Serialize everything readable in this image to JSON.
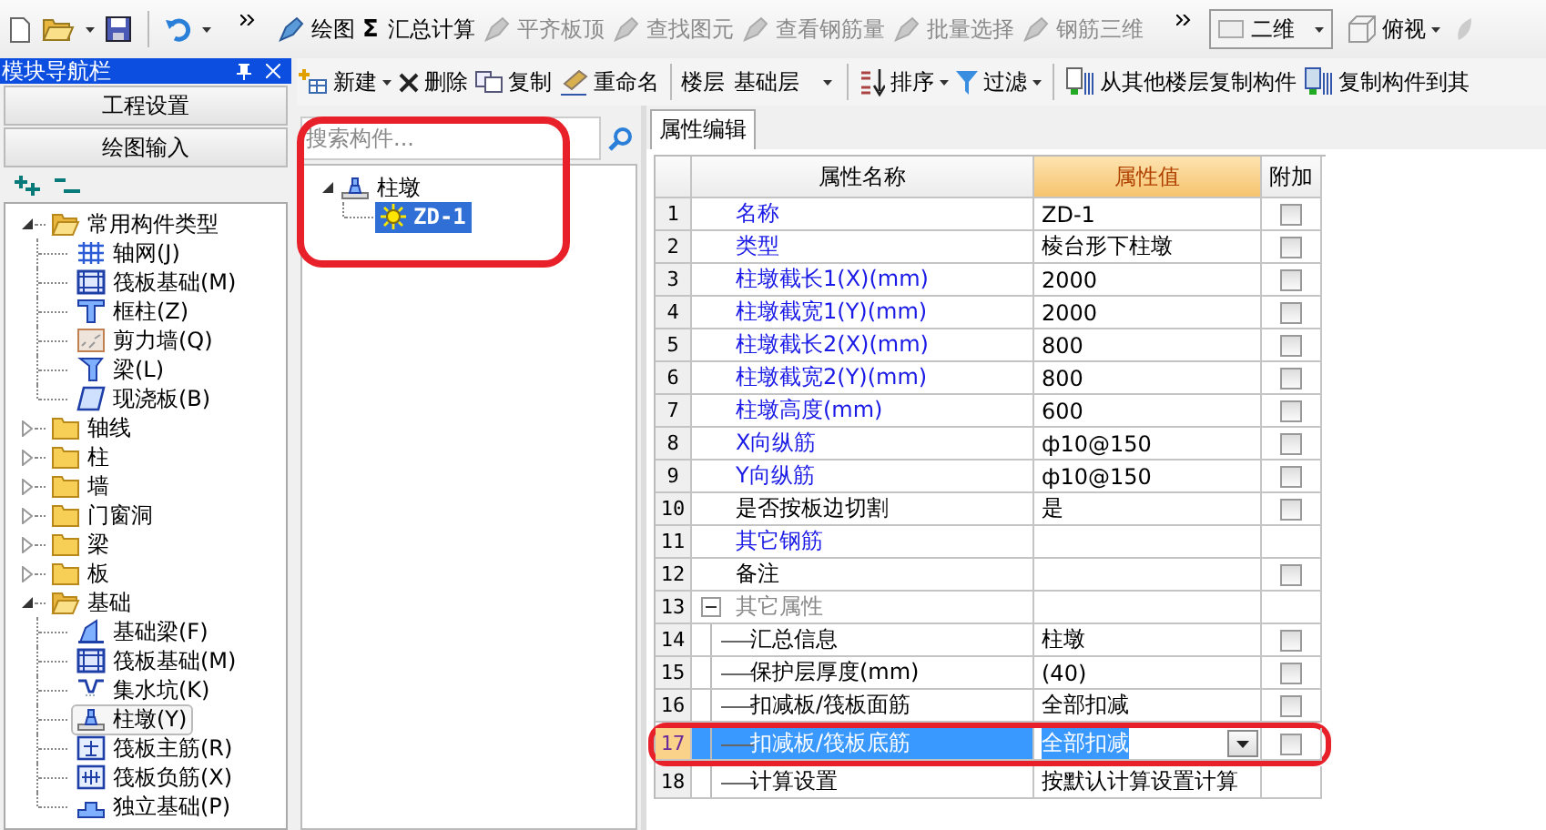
{
  "toolbar": {
    "tools": [
      {
        "label": "绘图",
        "disabled": false
      },
      {
        "label": "汇总计算",
        "symbol": "Σ",
        "disabled": false
      },
      {
        "label": "平齐板顶",
        "disabled": true
      },
      {
        "label": "查找图元",
        "disabled": true
      },
      {
        "label": "查看钢筋量",
        "disabled": true
      },
      {
        "label": "批量选择",
        "disabled": true
      },
      {
        "label": "钢筋三维",
        "disabled": true
      }
    ],
    "view_select": "二维",
    "view_button": "俯视"
  },
  "nav": {
    "title": "模块导航栏",
    "buttons": [
      "工程设置",
      "绘图输入"
    ],
    "tree": [
      {
        "label": "常用构件类型",
        "kind": "folder",
        "expanded": true,
        "selected": false,
        "children": [
          {
            "label": "轴网(J)",
            "kind": "grid",
            "selected": false
          },
          {
            "label": "筏板基础(M)",
            "kind": "raft",
            "selected": false
          },
          {
            "label": "框柱(Z)",
            "kind": "column",
            "selected": false
          },
          {
            "label": "剪力墙(Q)",
            "kind": "wall",
            "selected": false
          },
          {
            "label": "梁(L)",
            "kind": "beam",
            "selected": false
          },
          {
            "label": "现浇板(B)",
            "kind": "slab",
            "selected": false
          }
        ]
      },
      {
        "label": "轴线",
        "kind": "folder",
        "expanded": false,
        "selected": false
      },
      {
        "label": "柱",
        "kind": "folder",
        "expanded": false,
        "selected": false
      },
      {
        "label": "墙",
        "kind": "folder",
        "expanded": false,
        "selected": false
      },
      {
        "label": "门窗洞",
        "kind": "folder",
        "expanded": false,
        "selected": false
      },
      {
        "label": "梁",
        "kind": "folder",
        "expanded": false,
        "selected": false
      },
      {
        "label": "板",
        "kind": "folder",
        "expanded": false,
        "selected": false
      },
      {
        "label": "基础",
        "kind": "folder",
        "expanded": true,
        "selected": false,
        "children": [
          {
            "label": "基础梁(F)",
            "kind": "footing-beam",
            "selected": false
          },
          {
            "label": "筏板基础(M)",
            "kind": "raft",
            "selected": false
          },
          {
            "label": "集水坑(K)",
            "kind": "sump",
            "selected": false
          },
          {
            "label": "柱墩(Y)",
            "kind": "pier",
            "selected": true
          },
          {
            "label": "筏板主筋(R)",
            "kind": "main-rebar",
            "selected": false
          },
          {
            "label": "筏板负筋(X)",
            "kind": "neg-rebar",
            "selected": false
          },
          {
            "label": "独立基础(P)",
            "kind": "footing",
            "selected": false
          }
        ]
      }
    ]
  },
  "component_toolbar": {
    "new": "新建",
    "delete": "删除",
    "copy": "复制",
    "rename": "重命名",
    "floor_label": "楼层",
    "floor": "基础层",
    "sort": "排序",
    "filter": "过滤",
    "copy_from": "从其他楼层复制构件",
    "copy_to": "复制构件到其"
  },
  "component_panel": {
    "placeholder": "搜索构件...",
    "highlighted": true,
    "tree": [
      {
        "label": "柱墩",
        "kind": "pier",
        "expanded": true,
        "selected": false,
        "children": [
          {
            "label": "ZD-1",
            "kind": "instance",
            "selected": true
          }
        ]
      }
    ]
  },
  "properties": {
    "tab": {
      "label": "属性编辑",
      "selected": true
    },
    "columns": [
      "属性名称",
      "属性值",
      "附加"
    ],
    "rows": [
      {
        "no": "1",
        "name": "名称",
        "value": "ZD-1",
        "kind": "common",
        "checked": false,
        "selected": false
      },
      {
        "no": "2",
        "name": "类型",
        "value": "棱台形下柱墩",
        "kind": "common",
        "checked": false,
        "selected": false
      },
      {
        "no": "3",
        "name": "柱墩截长1(X)(mm)",
        "value": "2000",
        "kind": "common",
        "checked": false,
        "selected": false
      },
      {
        "no": "4",
        "name": "柱墩截宽1(Y)(mm)",
        "value": "2000",
        "kind": "common",
        "checked": false,
        "selected": false
      },
      {
        "no": "5",
        "name": "柱墩截长2(X)(mm)",
        "value": "800",
        "kind": "common",
        "checked": false,
        "selected": false
      },
      {
        "no": "6",
        "name": "柱墩截宽2(Y)(mm)",
        "value": "800",
        "kind": "common",
        "checked": false,
        "selected": false
      },
      {
        "no": "7",
        "name": "柱墩高度(mm)",
        "value": "600",
        "kind": "common",
        "checked": false,
        "selected": false
      },
      {
        "no": "8",
        "name": "X向纵筋",
        "value": "ф10@150",
        "kind": "common",
        "checked": false,
        "selected": false
      },
      {
        "no": "9",
        "name": "Y向纵筋",
        "value": "ф10@150",
        "kind": "common",
        "checked": false,
        "selected": false
      },
      {
        "no": "10",
        "name": "是否按板边切割",
        "value": "是",
        "kind": "plain",
        "checked": false,
        "selected": false
      },
      {
        "no": "11",
        "name": "其它钢筋",
        "kind": "common",
        "selected": false
      },
      {
        "no": "12",
        "name": "备注",
        "kind": "plain",
        "checked": false,
        "selected": false
      },
      {
        "no": "13",
        "name": "其它属性",
        "kind": "group",
        "expanded": true,
        "selected": false,
        "children": [
          {
            "no": "14",
            "name": "汇总信息",
            "value": "柱墩",
            "kind": "plain",
            "checked": false,
            "selected": false
          },
          {
            "no": "15",
            "name": "保护层厚度(mm)",
            "value": "(40)",
            "kind": "plain",
            "checked": false,
            "selected": false
          },
          {
            "no": "16",
            "name": "扣减板/筏板面筋",
            "value": "全部扣减",
            "kind": "plain",
            "checked": false,
            "selected": false
          },
          {
            "no": "17",
            "name": "扣减板/筏板底筋",
            "value": "全部扣减",
            "kind": "plain",
            "checked": false,
            "selected": true,
            "highlighted": true
          },
          {
            "no": "18",
            "name": "计算设置",
            "value": "按默认计算设置计算",
            "kind": "plain",
            "selected": false
          }
        ]
      }
    ]
  }
}
